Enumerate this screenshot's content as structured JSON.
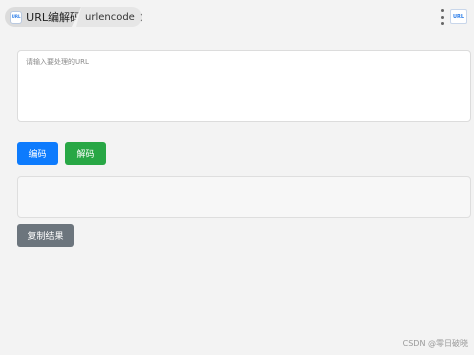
{
  "tabs": {
    "main": {
      "logo_text": "URL",
      "title": "URL编解码"
    },
    "sub": {
      "title": "urlencode",
      "close_icon": "close-icon"
    }
  },
  "header": {
    "more_icon": "more-vertical-icon",
    "plugin_badge_text": "URL"
  },
  "input": {
    "placeholder": "请输入要处理的URL",
    "value": ""
  },
  "buttons": {
    "encode_label": "编码",
    "decode_label": "解码",
    "copy_label": "复制结果"
  },
  "result": {
    "value": ""
  },
  "watermark": {
    "text": "CSDN @零日破晓"
  },
  "colors": {
    "encode": "#0d7bfd",
    "decode": "#28a745",
    "copy": "#6c757d",
    "background": "#f3f3f3"
  }
}
